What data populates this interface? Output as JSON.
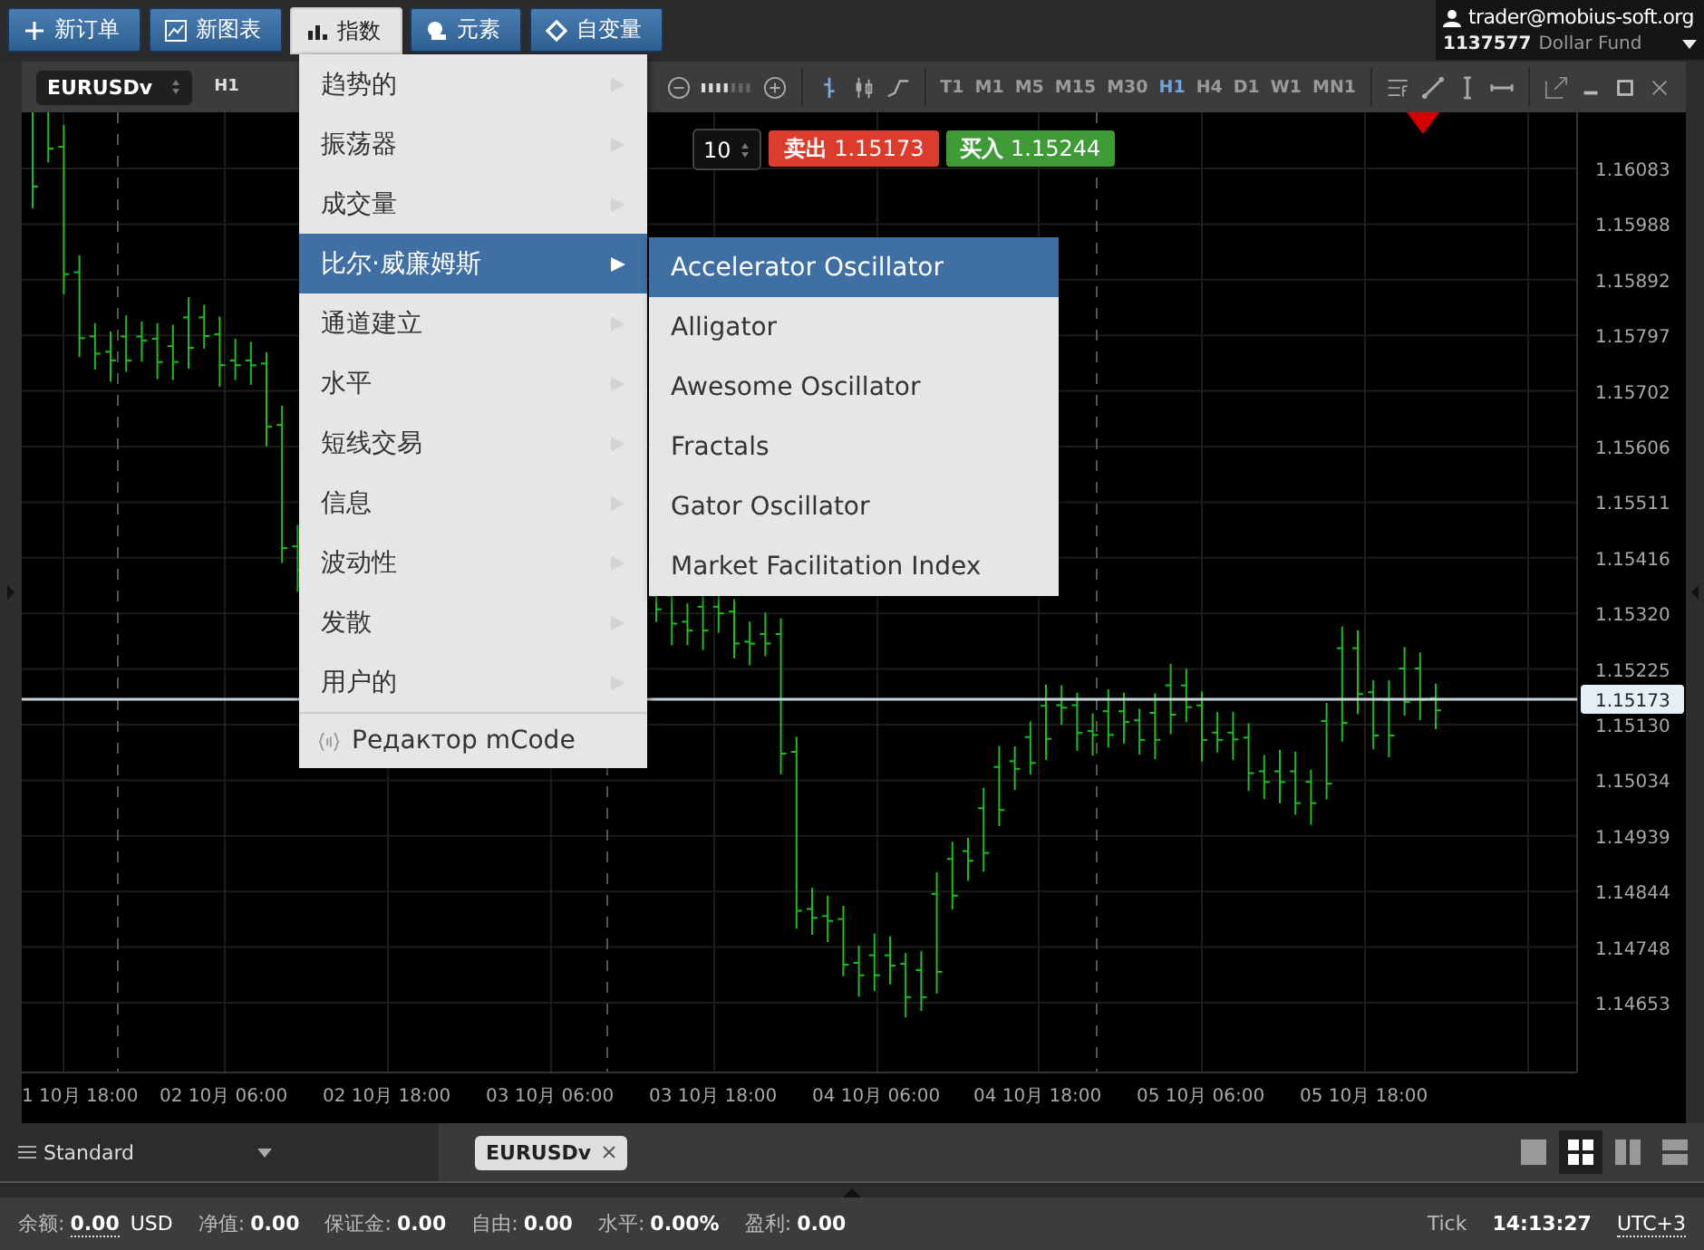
{
  "top_buttons": [
    {
      "label": "新订单",
      "selected": false
    },
    {
      "label": "新图表",
      "selected": false
    },
    {
      "label": "指数",
      "selected": true
    },
    {
      "label": "元素",
      "selected": false
    },
    {
      "label": "自变量",
      "selected": false
    }
  ],
  "account": {
    "email": "trader@mobius-soft.org",
    "number": "1137577",
    "name": "Dollar Fund"
  },
  "chart_toolbar": {
    "symbol": "EURUSDv",
    "period": "H1",
    "timeframes": [
      {
        "label": "T1",
        "selected": false
      },
      {
        "label": "M1",
        "selected": false
      },
      {
        "label": "M5",
        "selected": false
      },
      {
        "label": "M15",
        "selected": false
      },
      {
        "label": "M30",
        "selected": false
      },
      {
        "label": "H1",
        "selected": true
      },
      {
        "label": "H4",
        "selected": false
      },
      {
        "label": "D1",
        "selected": false
      },
      {
        "label": "W1",
        "selected": false
      },
      {
        "label": "MN1",
        "selected": false
      }
    ]
  },
  "order": {
    "volume": "10",
    "sell_label": "卖出",
    "sell_price": "1.15173",
    "buy_label": "买入",
    "buy_price": "1.15244"
  },
  "price_axis": [
    "1.16083",
    "1.15988",
    "1.15892",
    "1.15797",
    "1.15702",
    "1.15606",
    "1.15511",
    "1.15416",
    "1.15320",
    "1.15225",
    "1.15130",
    "1.15034",
    "1.14939",
    "1.14844",
    "1.14748",
    "1.14653"
  ],
  "current_price": "1.15173",
  "time_axis": [
    "1 10月 18:00",
    "02 10月 06:00",
    "02 10月 18:00",
    "03 10月 06:00",
    "03 10月 18:00",
    "04 10月 06:00",
    "04 10月 18:00",
    "05 10月 06:00",
    "05 10月 18:00"
  ],
  "indicator_menu": [
    {
      "label": "趋势的",
      "kind": "submenu",
      "selected": false
    },
    {
      "label": "振荡器",
      "kind": "submenu",
      "selected": false
    },
    {
      "label": "成交量",
      "kind": "submenu",
      "selected": false
    },
    {
      "label": "比尔·威廉姆斯",
      "kind": "submenu",
      "selected": true
    },
    {
      "label": "通道建立",
      "kind": "submenu",
      "selected": false
    },
    {
      "label": "水平",
      "kind": "submenu",
      "selected": false
    },
    {
      "label": "短线交易",
      "kind": "submenu",
      "selected": false
    },
    {
      "label": "信息",
      "kind": "submenu",
      "selected": false
    },
    {
      "label": "波动性",
      "kind": "submenu",
      "selected": false
    },
    {
      "label": "发散",
      "kind": "submenu",
      "selected": false
    },
    {
      "label": "用户的",
      "kind": "submenu",
      "selected": false
    },
    {
      "label": "Редактор mCode",
      "kind": "editor",
      "selected": false
    }
  ],
  "submenu": [
    {
      "label": "Accelerator Oscillator",
      "selected": true
    },
    {
      "label": "Alligator",
      "selected": false
    },
    {
      "label": "Awesome Oscillator",
      "selected": false
    },
    {
      "label": "Fractals",
      "selected": false
    },
    {
      "label": "Gator Oscillator",
      "selected": false
    },
    {
      "label": "Market Facilitation Index",
      "selected": false
    }
  ],
  "workspace": {
    "label": "Standard"
  },
  "chart_tabs": [
    {
      "label": "EURUSDv",
      "selected": true
    }
  ],
  "layouts": [
    {
      "kind": "single",
      "selected": false
    },
    {
      "kind": "grid",
      "selected": true
    },
    {
      "kind": "columns",
      "selected": false
    },
    {
      "kind": "rows",
      "selected": false
    }
  ],
  "status_bar": [
    {
      "label": "余额:",
      "value": "0.00",
      "unit": "USD"
    },
    {
      "label": "净值:",
      "value": "0.00"
    },
    {
      "label": "保证金:",
      "value": "0.00"
    },
    {
      "label": "自由:",
      "value": "0.00"
    },
    {
      "label": "水平:",
      "value": "0.00%"
    },
    {
      "label": "盈利:",
      "value": "0.00"
    }
  ],
  "clock": {
    "label": "Tick",
    "time": "14:13:27",
    "zone": "UTC+3"
  }
}
